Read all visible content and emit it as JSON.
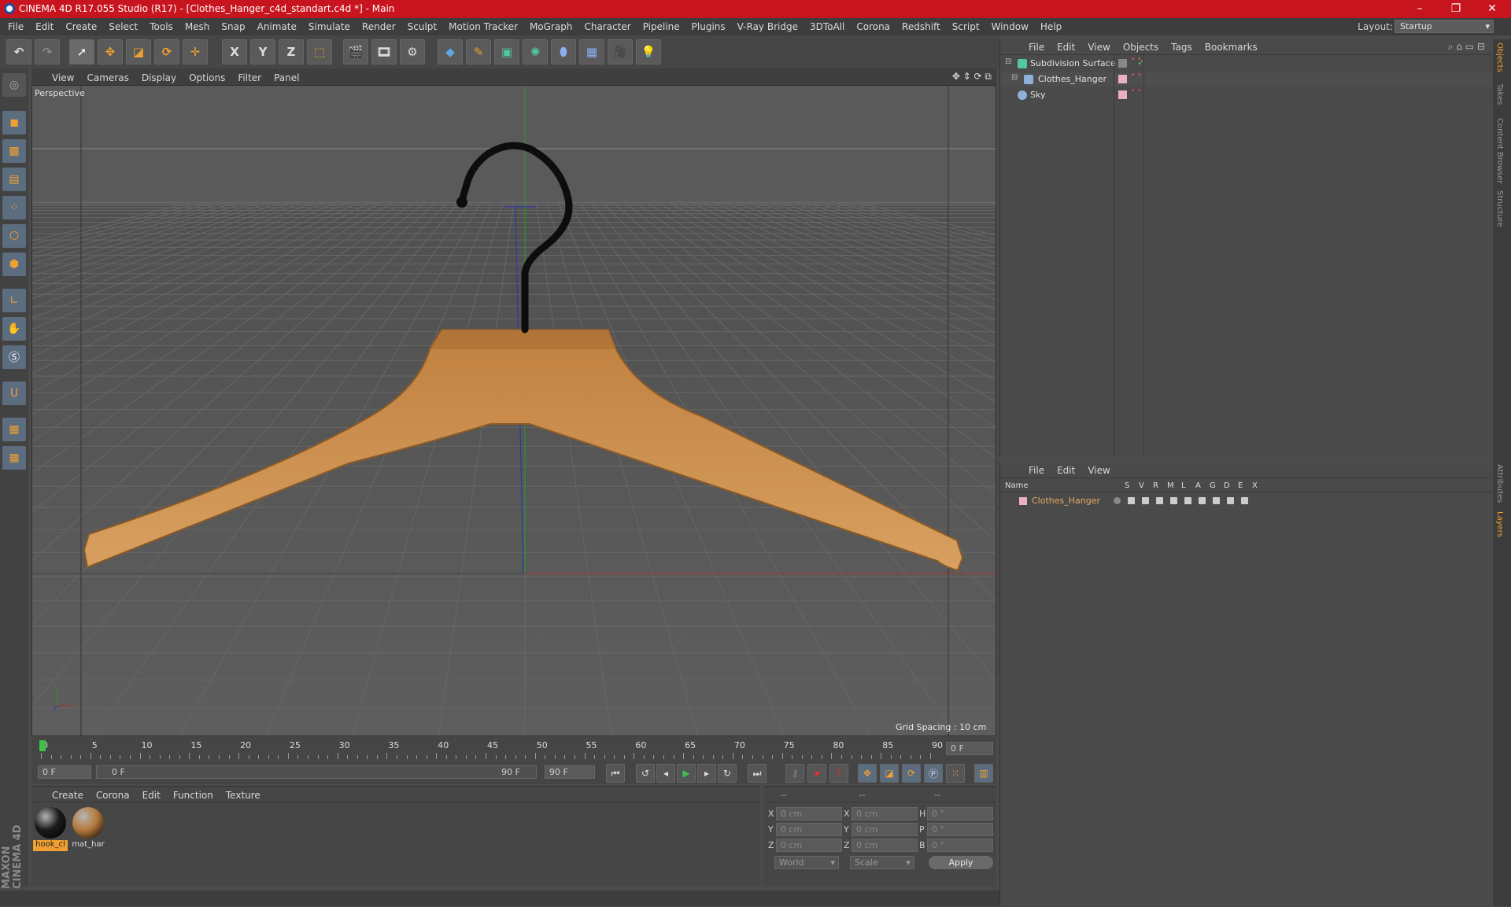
{
  "window": {
    "title": "CINEMA 4D R17.055 Studio (R17) - [Clothes_Hanger_c4d_standart.c4d *] - Main",
    "minimize_glyph": "–",
    "maximize_glyph": "❐",
    "close_glyph": "✕"
  },
  "menubar": {
    "items": [
      "File",
      "Edit",
      "Create",
      "Select",
      "Tools",
      "Mesh",
      "Snap",
      "Animate",
      "Simulate",
      "Render",
      "Sculpt",
      "Motion Tracker",
      "MoGraph",
      "Character",
      "Pipeline",
      "Plugins",
      "V-Ray Bridge",
      "3DToAll",
      "Corona",
      "Redshift",
      "Script",
      "Window",
      "Help"
    ],
    "layout_label": "Layout:",
    "layout_value": "Startup"
  },
  "toolbar": {
    "axis_x": "X",
    "axis_y": "Y",
    "axis_z": "Z"
  },
  "viewport": {
    "menu": [
      "View",
      "Cameras",
      "Display",
      "Options",
      "Filter",
      "Panel"
    ],
    "label": "Perspective",
    "grid_spacing": "Grid Spacing : 10 cm"
  },
  "timeline": {
    "ticks": [
      "0",
      "5",
      "10",
      "15",
      "20",
      "25",
      "30",
      "35",
      "40",
      "45",
      "50",
      "55",
      "60",
      "65",
      "70",
      "75",
      "80",
      "85",
      "90"
    ],
    "current_frame": "0 F",
    "start_field": "0 F",
    "range_start": "0 F",
    "range_end": "90 F",
    "end_field": "90 F"
  },
  "materials": {
    "menu": [
      "Create",
      "Corona",
      "Edit",
      "Function",
      "Texture"
    ],
    "items": [
      {
        "name": "hook_cl",
        "color": "#1a1a1a",
        "selected": true
      },
      {
        "name": "mat_har",
        "color": "#b57a3c",
        "selected": false
      }
    ]
  },
  "coords": {
    "header": [
      "--",
      "--",
      "--"
    ],
    "rows": [
      {
        "a": "X",
        "a_val": "0 cm",
        "b": "X",
        "b_val": "0 cm",
        "c": "H",
        "c_val": "0 °"
      },
      {
        "a": "Y",
        "a_val": "0 cm",
        "b": "Y",
        "b_val": "0 cm",
        "c": "P",
        "c_val": "0 °"
      },
      {
        "a": "Z",
        "a_val": "0 cm",
        "b": "Z",
        "b_val": "0 cm",
        "c": "B",
        "c_val": "0 °"
      }
    ],
    "world_select": "World",
    "scale_select": "Scale",
    "apply_label": "Apply"
  },
  "object_manager": {
    "menu": [
      "File",
      "Edit",
      "View",
      "Objects",
      "Tags",
      "Bookmarks"
    ],
    "objects": [
      {
        "name": "Subdivision Surface",
        "icon_color": "#52c8a0"
      },
      {
        "name": "Clothes_Hanger",
        "icon_color": "#8fb0d8"
      },
      {
        "name": "Sky",
        "icon_color": "#8fb0d8"
      }
    ]
  },
  "layer_manager": {
    "menu": [
      "File",
      "Edit",
      "View"
    ],
    "columns": [
      "Name",
      "S",
      "V",
      "R",
      "M",
      "L",
      "A",
      "G",
      "D",
      "E",
      "X"
    ],
    "layers": [
      {
        "name": "Clothes_Hanger",
        "color": "#e8a860"
      }
    ]
  },
  "right_tabs": [
    "Objects",
    "Takes",
    "Content Browser",
    "Structure",
    "Attributes",
    "Layers"
  ],
  "colors": {
    "titlebar": "#c8141e",
    "wood": "#c9894a",
    "hook": "#0d0d0d",
    "accent_orange": "#f0a030"
  }
}
